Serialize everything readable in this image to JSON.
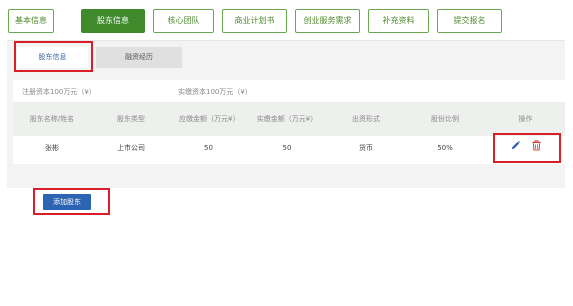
{
  "nav_tabs": [
    {
      "label": "基本信息"
    },
    {
      "label": "股东信息"
    },
    {
      "label": "核心团队"
    },
    {
      "label": "商业计划书"
    },
    {
      "label": "创业服务需求"
    },
    {
      "label": "补充资料"
    },
    {
      "label": "提交报名"
    }
  ],
  "sub_tabs": [
    {
      "label": "股东信息"
    },
    {
      "label": "融资经历"
    }
  ],
  "capital": {
    "registered": "注册资本100万元（¥）",
    "paid_in": "实缴资本100万元（¥）"
  },
  "table": {
    "headers": [
      "股东名称/姓名",
      "股东类型",
      "应缴金额（万元¥）",
      "实缴金额（万元¥）",
      "出资形式",
      "股份比例",
      "操作"
    ],
    "rows": [
      {
        "name": "张彬",
        "type": "上市公司",
        "due": "50",
        "paid": "50",
        "form": "货币",
        "ratio": "50%"
      }
    ]
  },
  "add_button": {
    "label": "添加股东"
  },
  "colors": {
    "accent_green": "#3f8b2c",
    "primary_blue": "#2d63b3",
    "highlight_red": "#d91e2a",
    "delete_red": "#d0312d"
  },
  "icons": {
    "edit": "pencil-icon",
    "delete": "trash-icon"
  }
}
